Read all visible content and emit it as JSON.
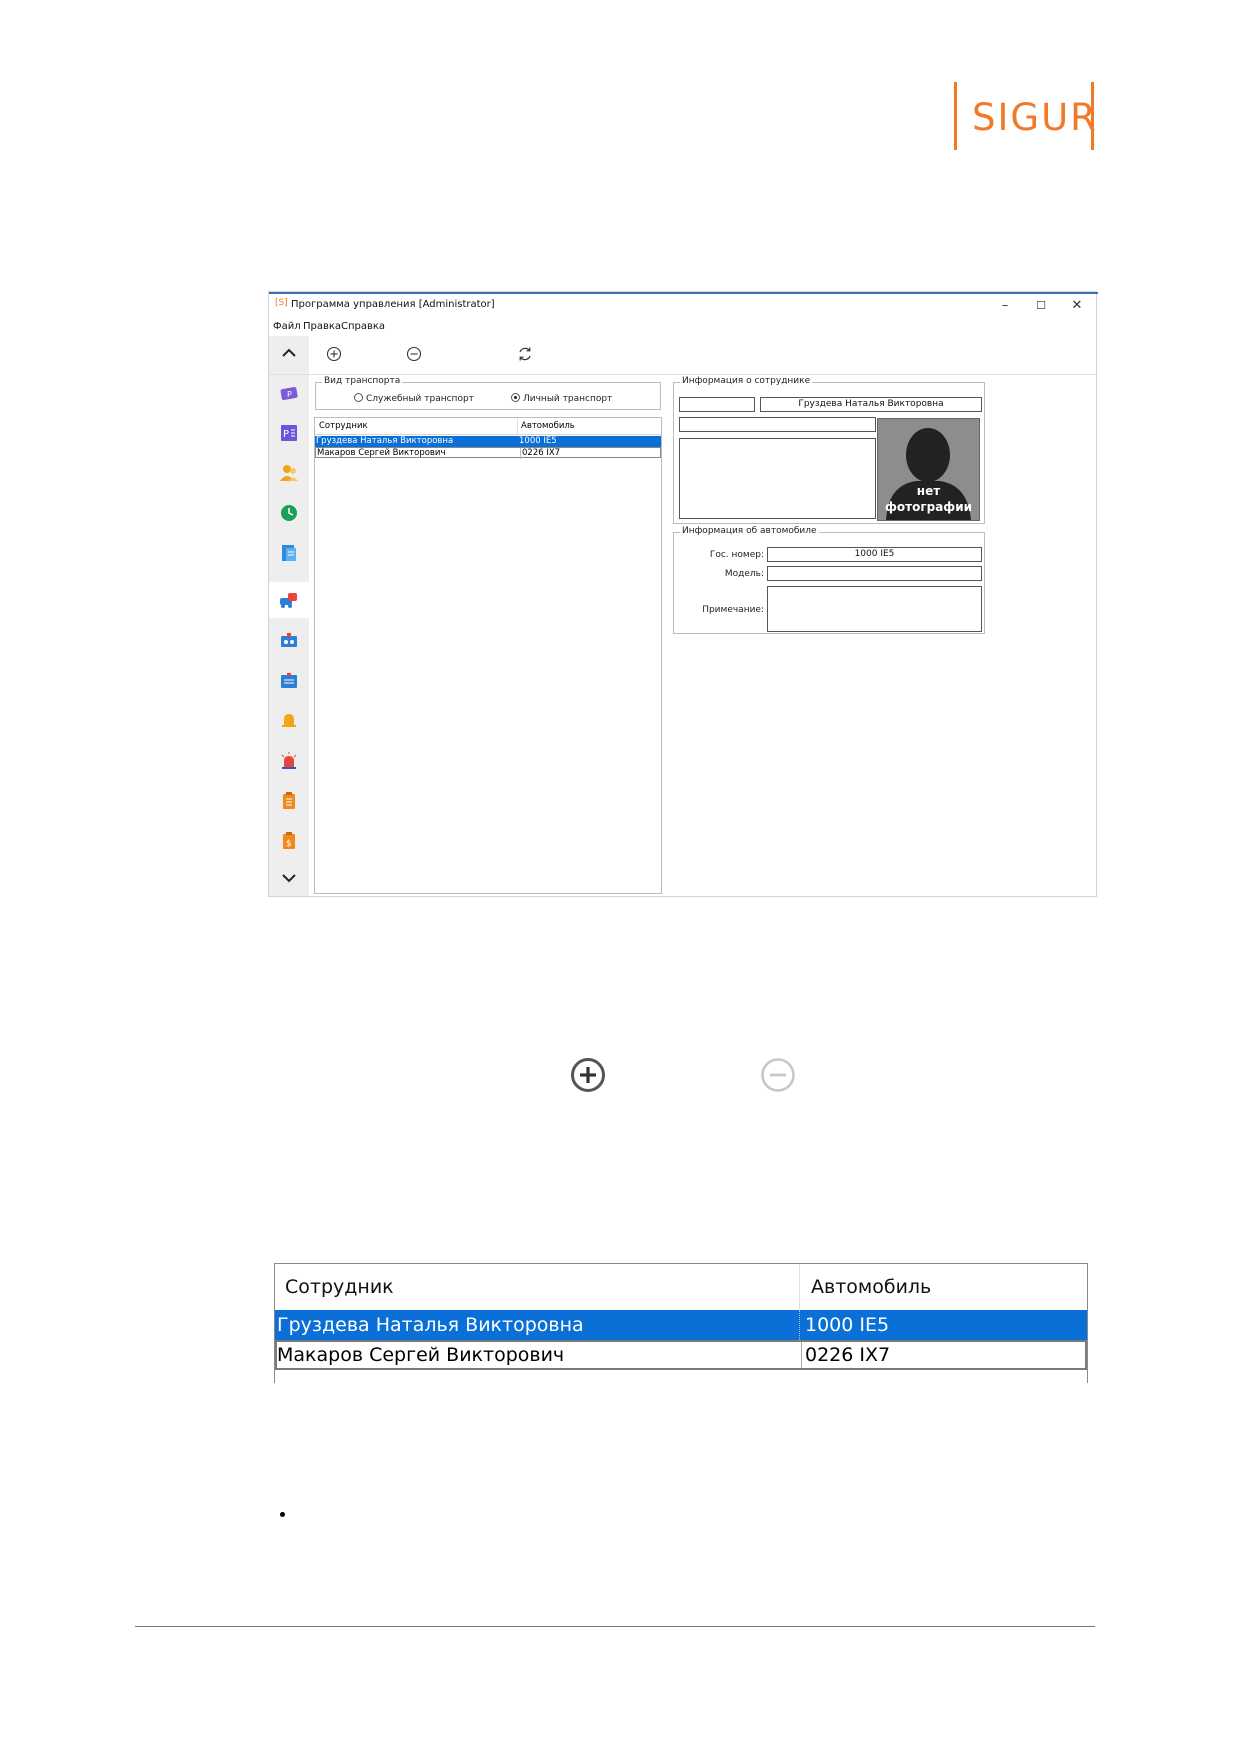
{
  "logo": {
    "text": "SIGUR",
    "color": "#f07a2a"
  },
  "window": {
    "app_icon": "[S]",
    "title": "Программа управления [Administrator]",
    "controls": {
      "minimize": "–",
      "maximize": "☐",
      "close": "✕"
    },
    "menu": [
      "Файл",
      "Правка",
      "Справка"
    ],
    "toolbar": {
      "add_icon": "plus-circle",
      "remove_icon": "minus-circle",
      "refresh_icon": "refresh"
    },
    "sidebar": {
      "up": "⌃",
      "down": "⌄",
      "icons": [
        "parking-icon",
        "presentation-icon",
        "users-icon",
        "clock-icon",
        "document-icon",
        "transport-icon",
        "id-card-icon",
        "badge-icon",
        "bell-icon",
        "alarm-icon",
        "report-icon",
        "report-money-icon"
      ],
      "active_index": 5
    },
    "transport_group": {
      "title": "Вид транспорта",
      "options": [
        {
          "label": "Служебный транспорт",
          "selected": false
        },
        {
          "label": "Личный транспорт",
          "selected": true
        }
      ]
    },
    "list": {
      "headers": [
        "Сотрудник",
        "Автомобиль"
      ],
      "rows": [
        {
          "employee": "Груздева Наталья Викторовна",
          "car": "1000 IE5",
          "selected": true
        },
        {
          "employee": "Макаров Сергей Викторович",
          "car": "0226 IX7",
          "selected": false
        }
      ]
    },
    "employee_info": {
      "title": "Информация о сотруднике",
      "name": "Груздева Наталья Викторовна",
      "photo_label_1": "нет",
      "photo_label_2": "фотографии"
    },
    "car_info": {
      "title": "Информация об автомобиле",
      "plate_label": "Гос. номер:",
      "plate_value": "1000 IE5",
      "model_label": "Модель:",
      "model_value": "",
      "note_label": "Примечание:",
      "note_value": ""
    }
  },
  "zoom_icons": {
    "add": "plus-circle",
    "remove": "minus-circle"
  },
  "zoom_table": {
    "headers": [
      "Сотрудник",
      "Автомобиль"
    ],
    "rows": [
      {
        "employee": "Груздева Наталья Викторовна",
        "car": "1000 IE5",
        "selected": true
      },
      {
        "employee": "Макаров Сергей Викторович",
        "car": "0226 IX7",
        "selected": false
      }
    ]
  },
  "colors": {
    "selection": "#0a6fd6",
    "accent": "#f07a2a"
  }
}
